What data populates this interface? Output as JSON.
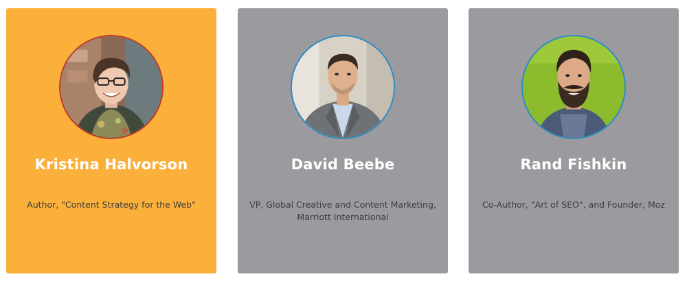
{
  "speakers": [
    {
      "name": "Kristina Halvorson",
      "role": "Author, \"Content Strategy for the Web\"",
      "card_color": "#fbb03b",
      "photo": "portrait-photo"
    },
    {
      "name": "David Beebe",
      "role_line1": "VP, Global Creative and Content Marketing,",
      "role_line2": "Marriott International",
      "card_color": "#9b9b9f",
      "photo": "portrait-photo"
    },
    {
      "name": "Rand Fishkin",
      "role": "Co-Author, \"Art of SEO\", and Founder, Moz",
      "card_color": "#9b9b9f",
      "photo": "portrait-photo"
    }
  ]
}
